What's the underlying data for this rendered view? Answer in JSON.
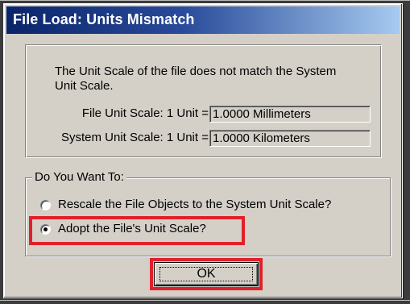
{
  "dialog": {
    "title": "File Load: Units Mismatch"
  },
  "info": {
    "message": "The Unit Scale of the file does not match the System Unit Scale.",
    "file_unit_label": "File Unit Scale: 1 Unit =",
    "file_unit_value": "1.0000 Millimeters",
    "system_unit_label": "System Unit Scale: 1 Unit =",
    "system_unit_value": "1.0000 Kilometers"
  },
  "options": {
    "legend": "Do You Want To:",
    "rescale_label": "Rescale the File Objects to the System Unit Scale?",
    "rescale_selected": false,
    "adopt_label": "Adopt the File's Unit Scale?",
    "adopt_selected": true
  },
  "buttons": {
    "ok_label": "OK"
  },
  "colors": {
    "titlebar_start": "#0a246a",
    "titlebar_end": "#a6caf0",
    "highlight": "#e0202a",
    "dialog_bg": "#d4d0c8"
  }
}
